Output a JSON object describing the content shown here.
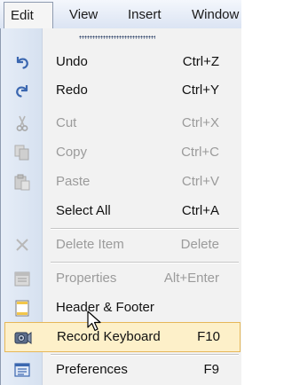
{
  "menubar": {
    "tabs": [
      {
        "label": "Edit"
      },
      {
        "label": "View"
      },
      {
        "label": "Insert"
      },
      {
        "label": "Window"
      }
    ]
  },
  "menu": {
    "items": [
      {
        "label": "Undo",
        "shortcut": "Ctrl+Z",
        "icon": "undo-icon",
        "enabled": true
      },
      {
        "label": "Redo",
        "shortcut": "Ctrl+Y",
        "icon": "redo-icon",
        "enabled": true
      },
      {
        "label": "Cut",
        "shortcut": "Ctrl+X",
        "icon": "cut-icon",
        "enabled": false
      },
      {
        "label": "Copy",
        "shortcut": "Ctrl+C",
        "icon": "copy-icon",
        "enabled": false
      },
      {
        "label": "Paste",
        "shortcut": "Ctrl+V",
        "icon": "paste-icon",
        "enabled": false
      },
      {
        "label": "Select All",
        "shortcut": "Ctrl+A",
        "icon": "",
        "enabled": true
      },
      {
        "label": "Delete Item",
        "shortcut": "Delete",
        "icon": "delete-icon",
        "enabled": false
      },
      {
        "label": "Properties",
        "shortcut": "Alt+Enter",
        "icon": "properties-icon",
        "enabled": false
      },
      {
        "label": "Header & Footer",
        "shortcut": "",
        "icon": "header-footer-icon",
        "enabled": true
      },
      {
        "label": "Record Keyboard",
        "shortcut": "F10",
        "icon": "record-keyboard-icon",
        "enabled": true,
        "hovered": true
      },
      {
        "label": "Preferences",
        "shortcut": "F9",
        "icon": "preferences-icon",
        "enabled": true
      }
    ]
  },
  "colors": {
    "highlight_fill": "#fdf0c9",
    "highlight_border": "#e6b758",
    "disabled_text": "#9b9b9b",
    "gutter": "#dfe7f3",
    "icon_blue": "#3b67b0"
  }
}
